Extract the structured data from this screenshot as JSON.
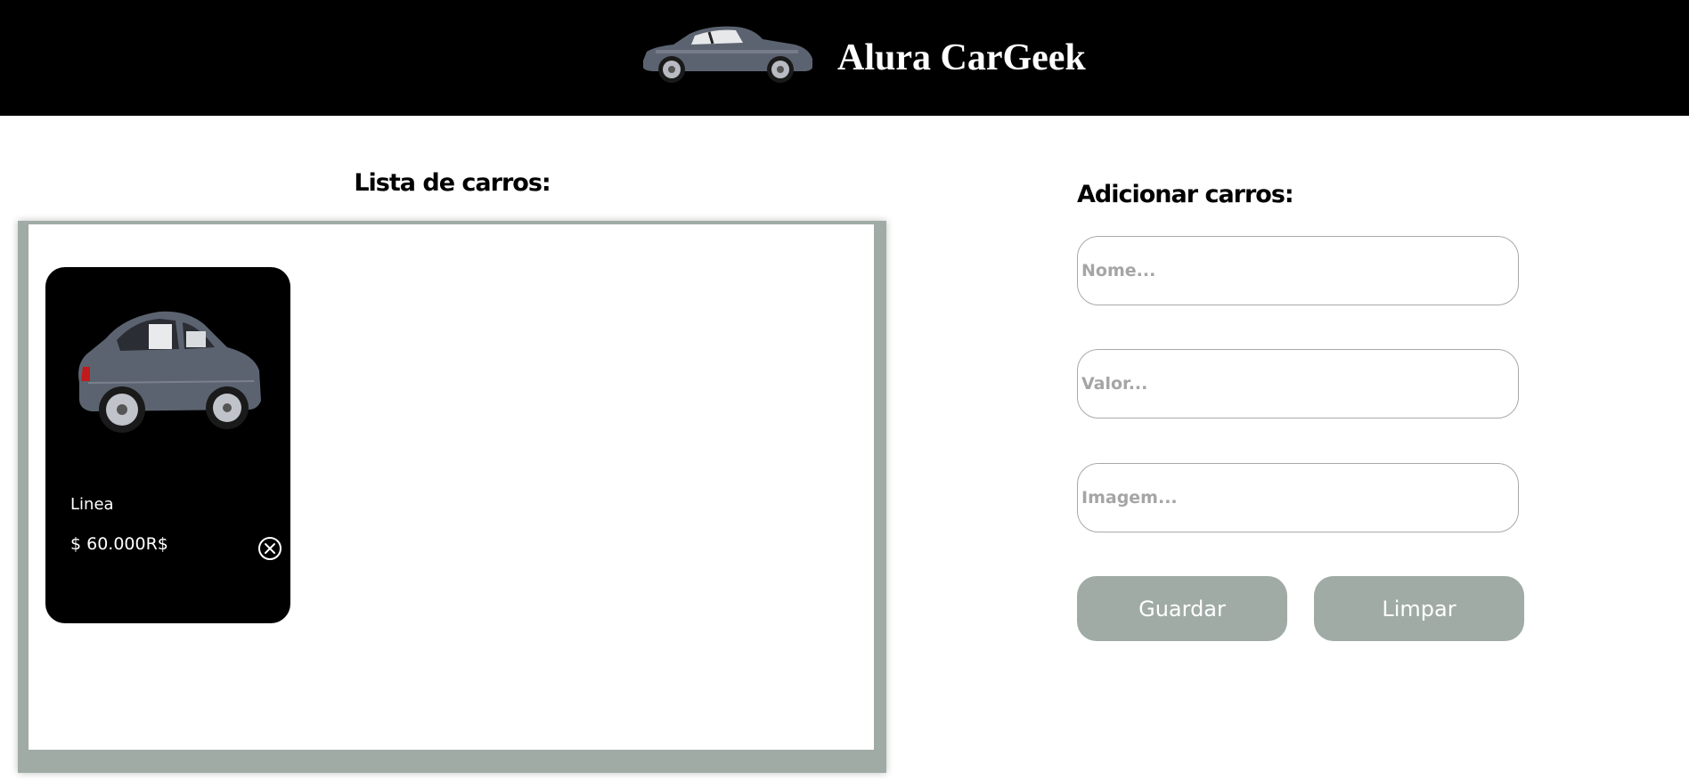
{
  "header": {
    "brand": "Alura CarGeek",
    "logo_icon": "car-logo-icon"
  },
  "list": {
    "title": "Lista de carros:",
    "cards": [
      {
        "name": "Linea",
        "price": "$ 60.000R$",
        "image_icon": "car-image",
        "delete_icon": "close-circle-icon"
      }
    ]
  },
  "form": {
    "title": "Adicionar carros:",
    "name_placeholder": "Nome...",
    "value_placeholder": "Valor...",
    "image_placeholder": "Imagem...",
    "save_label": "Guardar",
    "clear_label": "Limpar"
  },
  "colors": {
    "header_bg": "#000000",
    "accent_gray": "#a0aba6",
    "card_bg": "#000000",
    "car_body": "#5c6370"
  }
}
